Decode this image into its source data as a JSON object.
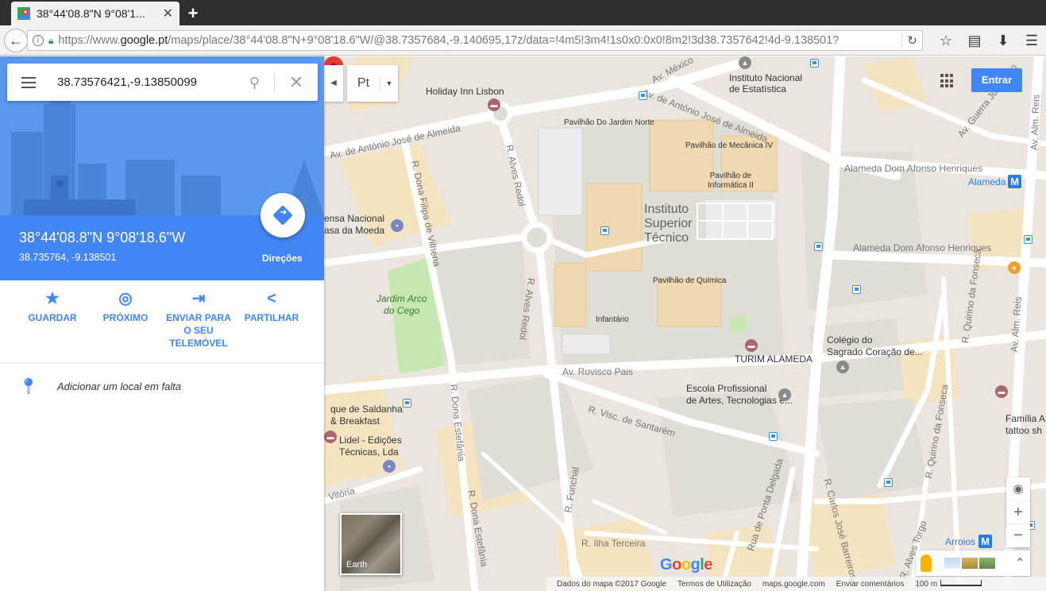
{
  "browser": {
    "tab_title": "38°44'08.8\"N 9°08'1...",
    "url_prefix": "https://www.",
    "url_domain": "google.pt",
    "url_rest": "/maps/place/38°44'08.8\"N+9°08'18.6\"W/@38.7357684,-9.140695,17z/data=!4m5!3m4!1s0x0:0x0!8m2!3d38.7357642!4d-9.138501?"
  },
  "search": {
    "value": "38.73576421,-9.13850099"
  },
  "place": {
    "title": "38°44'08.8\"N 9°08'18.6\"W",
    "subtitle": "38.735764, -9.138501",
    "directions_label": "Direções"
  },
  "actions": [
    {
      "label": "GUARDAR",
      "icon": "star-icon"
    },
    {
      "label": "PRÓXIMO",
      "icon": "nearby-icon"
    },
    {
      "label": "ENVIAR PARA O SEU TELEMÓVEL",
      "icon": "send-to-phone-icon"
    },
    {
      "label": "PARTILHAR",
      "icon": "share-icon"
    }
  ],
  "add_place": "Adicionar um local em falta",
  "map": {
    "lang_value": "Pt",
    "signin_label": "Entrar",
    "earth_label": "Earth",
    "logo": "Google",
    "labels": {
      "holiday_inn": "Holiday Inn Lisbon",
      "ine": "Instituto Nacional\nde Estatística",
      "pav_jardim_norte": "Pavilhão Do Jardim Norte",
      "pav_mecanica": "Pavilhão de Mecânica IV",
      "pav_informatica": "Pavilhão de\nInformática II",
      "ist": "Instituto\nSuperior\nTécnico",
      "pav_quimica": "Pavilhão de Química",
      "infantario": "Infantário",
      "casa_moeda": "ensa Nacional\nasa da Moeda",
      "jardim_arco": "Jardim Arco\ndo Cego",
      "alameda_metro": "Alameda",
      "colegio": "Colégio do\nSagrado Coração de...",
      "turim": "TURIM ALAMEDA",
      "escola": "Escola Profissional\nde Artes, Tecnologias e...",
      "saldanha": "que de Saldanha\n& Breakfast",
      "lidel": "Lidel - Edições\nTécnicas, Lda",
      "familia": "Família A\ntattoo sh",
      "arroios": "Arroios"
    },
    "roads": {
      "av_antonio_jose_almeida_left": "Av. de António José de Almeida",
      "av_antonio_jose_almeida_top": "Av. de António José de Almeida",
      "av_mexico": "Av. México",
      "r_alves_redol_top": "R. Alves Redol",
      "r_alves_redol_bottom": "R. Alves Redol",
      "r_dona_filipa": "R. Dona Filipa de Vilhena",
      "alameda_dom_afonso_1": "Alameda Dom Afonso Henriques",
      "alameda_dom_afonso_2": "Alameda Dom Afonso Henriques",
      "av_rovisco_pais": "Av. Rovisco Pais",
      "r_visc_santarem": "R. Visc. de Santarém",
      "r_dona_estefania_1": "R. Dona Estefânia",
      "r_dona_estefania_2": "R. Dona Estefânia",
      "r_funchal": "R. Funchal",
      "r_ilha_terceira": "R. Ilha Terceira",
      "rua_ponta_delgada": "Rua de Ponta Delgada",
      "r_carlos_jose_barreiros": "R. Carlos José Barreiros",
      "r_quirino_fonseca_1": "R. Quirino da Fonseca",
      "r_quirino_fonseca_2": "R. Quirino da Fonseca",
      "av_alm_reis_1": "Av. Alm. Reis",
      "av_alm_reis_2": "Av. Alm. Reis",
      "av_guerra_junqueiro": "Av. Guerra Junqueiro",
      "r_alves_torgo": "R. Alves Torgo",
      "av_vitoria": "Vitória"
    },
    "footer": {
      "data": "Dados do mapa ©2017 Google",
      "terms": "Termos de Utilização",
      "site": "maps.google.com",
      "feedback": "Enviar comentários",
      "scale": "100 m"
    }
  }
}
